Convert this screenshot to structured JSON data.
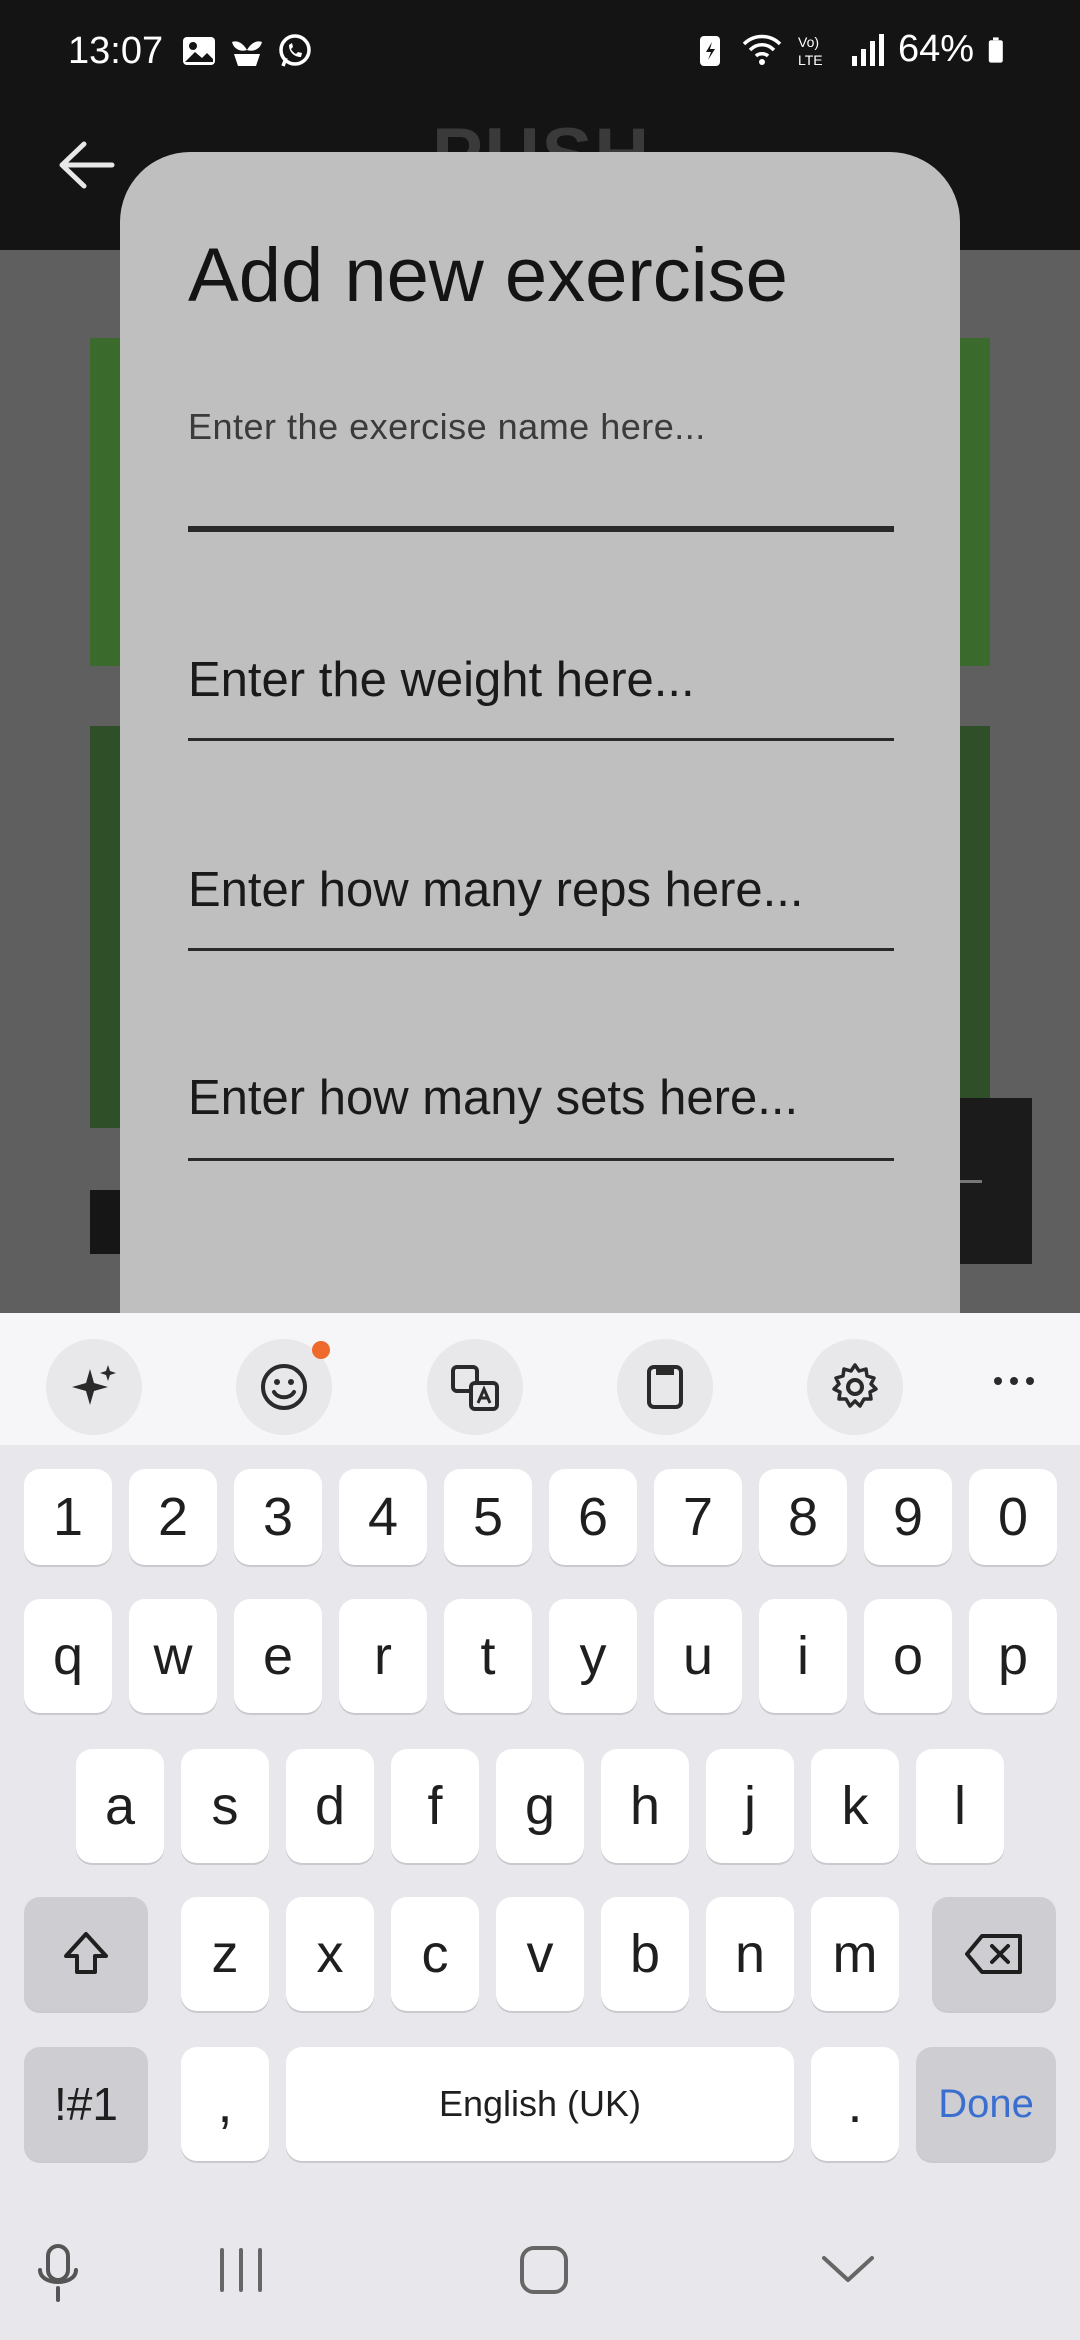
{
  "status_bar": {
    "time": "13:07",
    "battery": "64%",
    "left_icons": [
      "gallery-icon",
      "plant-icon",
      "whatsapp-icon"
    ],
    "right_icons": [
      "battery-saver-icon",
      "wifi-icon",
      "volte-icon",
      "signal-icon",
      "battery-icon"
    ]
  },
  "app_background": {
    "title": "PUSH",
    "accent_color": "#3a6a2c"
  },
  "dialog": {
    "title": "Add new exercise",
    "fields": {
      "name": {
        "label": "Enter the exercise name here...",
        "value": ""
      },
      "weight": {
        "hint": "Enter the weight here..."
      },
      "reps": {
        "hint": "Enter how many reps here..."
      },
      "sets": {
        "hint": "Enter how many sets here..."
      }
    }
  },
  "keyboard": {
    "toolbar": [
      "ai-sparkle-icon",
      "emoji-icon",
      "translate-icon",
      "clipboard-icon",
      "settings-icon",
      "more-icon"
    ],
    "number_row": [
      "1",
      "2",
      "3",
      "4",
      "5",
      "6",
      "7",
      "8",
      "9",
      "0"
    ],
    "row1": [
      "q",
      "w",
      "e",
      "r",
      "t",
      "y",
      "u",
      "i",
      "o",
      "p"
    ],
    "row2": [
      "a",
      "s",
      "d",
      "f",
      "g",
      "h",
      "j",
      "k",
      "l"
    ],
    "row3": [
      "z",
      "x",
      "c",
      "v",
      "b",
      "n",
      "m"
    ],
    "symbols_label": "!#1",
    "comma": ",",
    "space_label": "English (UK)",
    "period": ".",
    "done_label": "Done"
  },
  "nav_bar": [
    "microphone-icon",
    "recents-icon",
    "home-icon",
    "hide-keyboard-icon"
  ]
}
